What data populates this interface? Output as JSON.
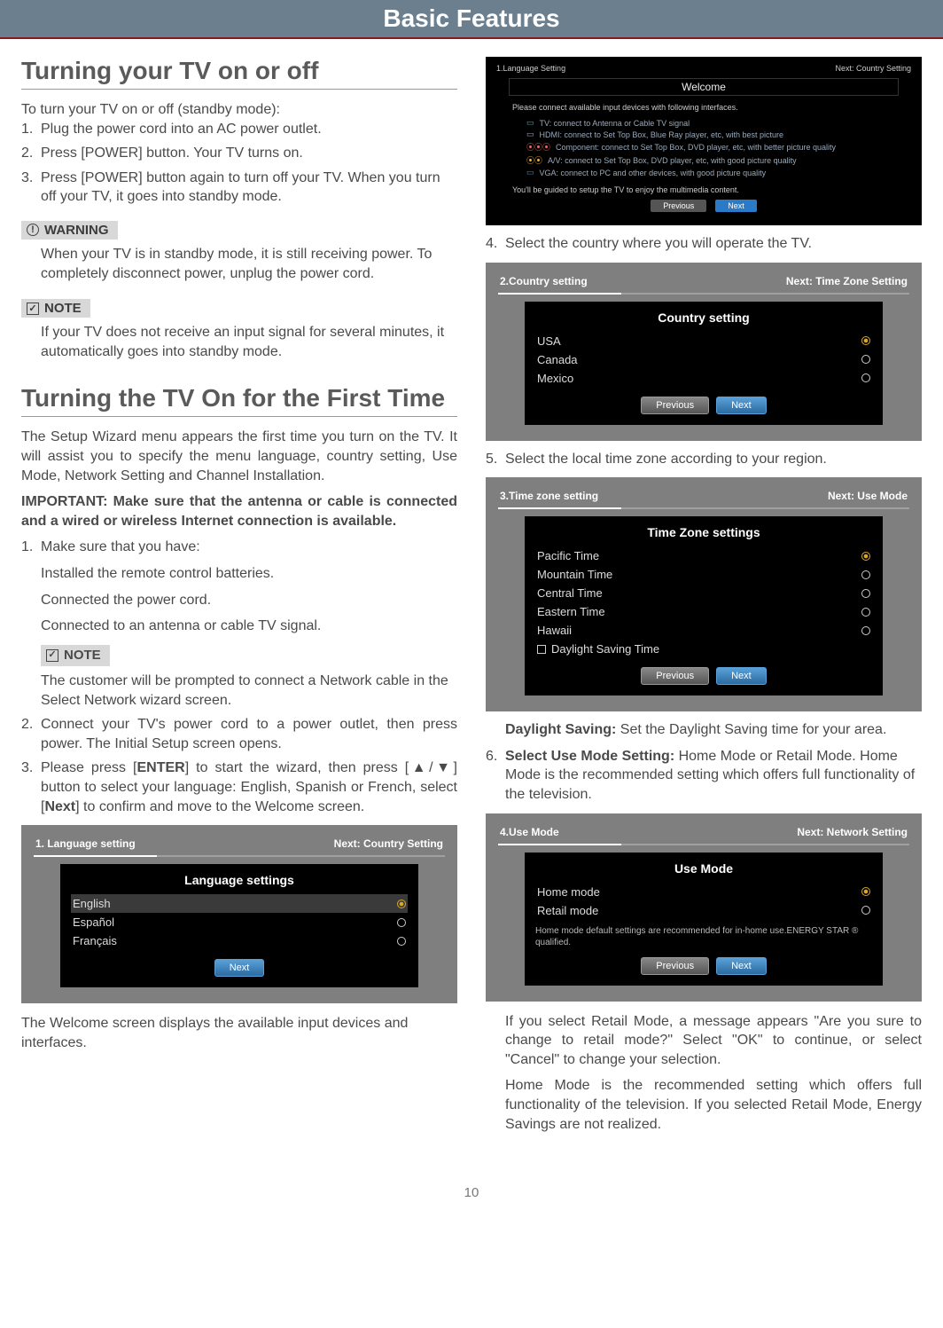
{
  "header": {
    "title": "Basic Features"
  },
  "section1": {
    "heading": "Turning your TV on or off",
    "intro": "To turn your TV on or off (standby mode):",
    "steps": [
      "Plug the power cord into an AC power outlet.",
      "Press [POWER] button. Your TV turns on.",
      "Press [POWER] button again to turn off your TV. When you turn off your TV, it goes into standby mode."
    ],
    "warning_label": "WARNING",
    "warning_text": "When your TV is in standby mode, it is still receiving power. To completely disconnect power, unplug the power cord.",
    "note_label": "NOTE",
    "note_text": "If your TV does not receive an input signal for several minutes, it automatically goes into standby mode."
  },
  "section2": {
    "heading": "Turning the TV On for the First Time",
    "intro": "The Setup Wizard menu appears the first time you turn on the TV. It will assist you to specify the menu language, country setting, Use Mode, Network Setting and Channel Installation.",
    "important": "IMPORTANT: Make sure that the antenna or cable is connected and a wired or wireless Internet connection is available.",
    "step1_lead": "Make sure that you have:",
    "step1_items": [
      "Installed the remote control batteries.",
      "Connected the power cord.",
      "Connected to an antenna or cable TV signal."
    ],
    "note_label": "NOTE",
    "note_text": "The customer will be prompted to connect a Network cable in the Select Network wizard screen.",
    "step2": "Connect your TV's power cord to a power outlet, then press power. The Initial Setup screen opens.",
    "step3_a": "Please press [",
    "step3_enter": "ENTER",
    "step3_b": "] to start the wizard, then press [▲/▼] button to select your language: English, Spanish or French, select [",
    "step3_next": "Next",
    "step3_c": "] to confirm and move to the Welcome screen.",
    "after_lang": "The Welcome screen displays the available input devices and interfaces."
  },
  "wizard_lang": {
    "left": "1. Language setting",
    "right": "Next: Country Setting",
    "title": "Language settings",
    "options": [
      "English",
      "Español",
      "Français"
    ],
    "next": "Next"
  },
  "welcome_shot": {
    "left": "1.Language Setting",
    "right": "Next: Country Setting",
    "title": "Welcome",
    "lead": "Please connect available input devices with following interfaces.",
    "lines": [
      "TV: connect to Antenna or Cable TV signal",
      "HDMI: connect to Set Top Box, Blue Ray player, etc, with best picture",
      "Component: connect to Set Top Box, DVD player, etc, with better picture quality",
      "A/V: connect to Set Top Box, DVD player, etc, with good picture quality",
      "VGA: connect to PC and other devices, with good picture quality"
    ],
    "foot": "You'll be guided to setup the TV to enjoy the multimedia content.",
    "prev": "Previous",
    "next": "Next"
  },
  "right_steps": {
    "s4": "Select the country where you will operate the TV.",
    "s5": "Select the local time zone according to your region.",
    "daylight_label": "Daylight Saving:",
    "daylight_text": " Set the Daylight Saving time for your area.",
    "s6_label": "Select Use Mode Setting:",
    "s6_text": " Home Mode or Retail Mode. Home Mode is the recommended setting which offers full functionality of the television.",
    "retail_msg": "If you select Retail Mode, a message appears \"Are you sure to change to retail mode?\" Select \"OK\" to continue, or select \"Cancel\" to change your selection.",
    "retail_msg2": "Home Mode is the recommended setting which offers full functionality of the television. If you selected Retail Mode, Energy Savings are not realized."
  },
  "wizard_country": {
    "left": "2.Country setting",
    "right": "Next: Time Zone Setting",
    "title": "Country setting",
    "options": [
      "USA",
      "Canada",
      "Mexico"
    ],
    "prev": "Previous",
    "next": "Next"
  },
  "wizard_tz": {
    "left": "3.Time zone setting",
    "right": "Next: Use Mode",
    "title": "Time Zone settings",
    "options": [
      "Pacific Time",
      "Mountain Time",
      "Central Time",
      "Eastern Time",
      "Hawaii"
    ],
    "checkbox": "Daylight Saving Time",
    "prev": "Previous",
    "next": "Next"
  },
  "wizard_mode": {
    "left": "4.Use Mode",
    "right": "Next: Network Setting",
    "title": "Use Mode",
    "options": [
      "Home mode",
      "Retail mode"
    ],
    "sub": "Home mode default settings are recommended for in-home use.ENERGY STAR ® qualified.",
    "prev": "Previous",
    "next": "Next"
  },
  "labels": {
    "n1": "1.",
    "n2": "2.",
    "n3": "3.",
    "n4": "4.",
    "n5": "5.",
    "n6": "6."
  },
  "page_number": "10"
}
